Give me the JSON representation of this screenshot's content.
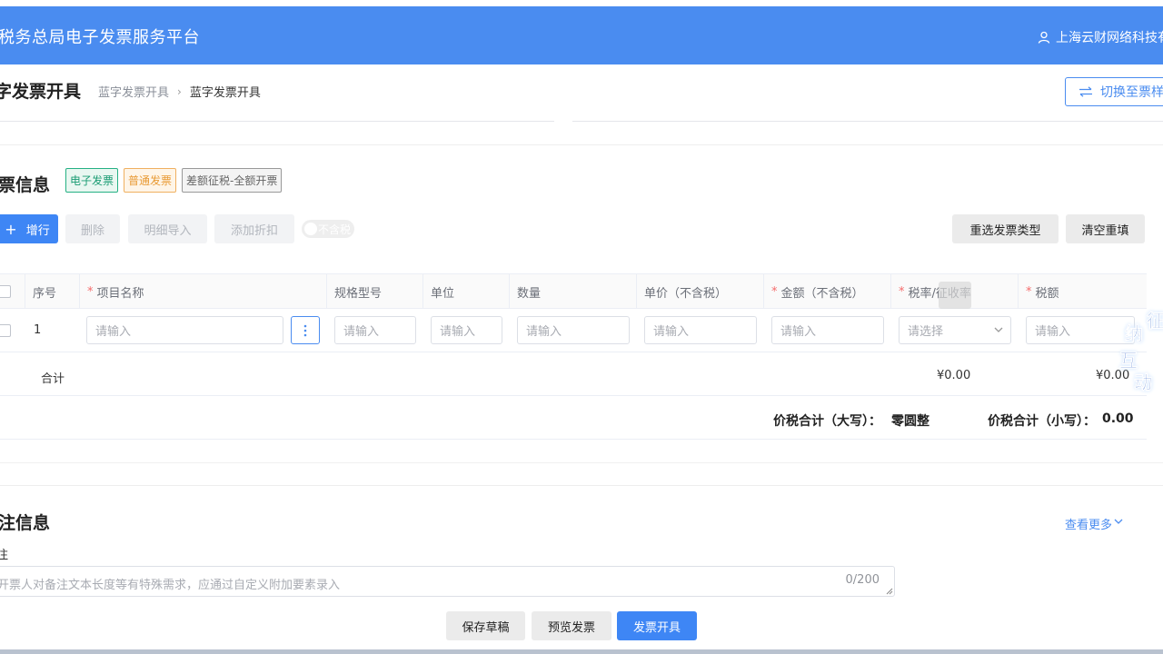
{
  "header": {
    "app_title": "税务总局电子发票服务平台",
    "user_name": "上海云财网络科技有"
  },
  "page": {
    "title": "字发票开具",
    "breadcrumb": [
      "蓝字发票开具",
      "蓝字发票开具"
    ],
    "switch_button": "切换至票样"
  },
  "invoice_info": {
    "section_title": "票信息",
    "tags": [
      "电子发票",
      "普通发票",
      "差额征税-全额开票"
    ],
    "toolbar": {
      "add": "增行",
      "delete": "删除",
      "import": "明细导入",
      "discount": "添加折扣",
      "tax_toggle": "不含税",
      "reselect": "重选发票类型",
      "clear": "清空重填"
    },
    "columns": [
      "序号",
      "项目名称",
      "规格型号",
      "单位",
      "数量",
      "单价（不含税）",
      "金额（不含税）",
      "税率/征收率",
      "税额"
    ],
    "required_columns": [
      "项目名称",
      "金额（不含税）",
      "税率/征收率",
      "税额"
    ],
    "row": {
      "index": "1",
      "placeholder_input": "请输入",
      "placeholder_select": "请选择"
    },
    "sum_label": "合计",
    "sum_amount": "¥0.00",
    "sum_tax": "¥0.00",
    "total_upper_label": "价税合计（大写）：",
    "total_upper_value": "零圆整",
    "total_lower_label": "价税合计（小写）：",
    "total_lower_value": "0.00"
  },
  "remarks": {
    "section_title": "注信息",
    "view_more": "查看更多",
    "label": "注",
    "placeholder": "开票人对备注文本长度等有特殊需求，应通过自定义附加要素录入",
    "counter": "0/200"
  },
  "footer": {
    "save_draft": "保存草稿",
    "preview": "预览发票",
    "issue": "发票开具"
  },
  "overlay": {
    "mascot_text": [
      "征",
      "纳",
      "互",
      "动"
    ]
  },
  "colors": {
    "header_blue": "#4a8cf0",
    "primary": "#3e86f5",
    "required_red": "#f56c6c"
  }
}
